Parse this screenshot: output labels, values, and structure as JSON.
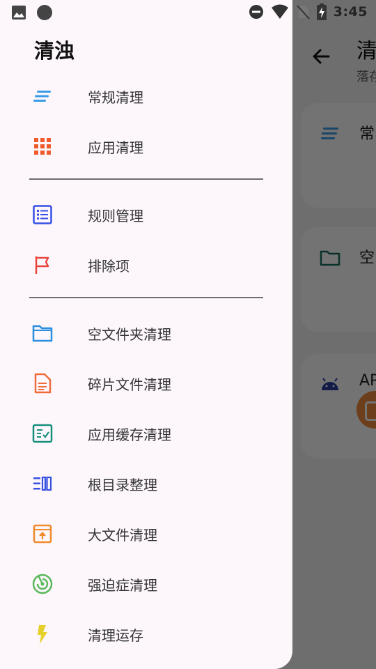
{
  "status_bar": {
    "time": "3:45",
    "icons": [
      "image-icon",
      "circle-icon",
      "dnd-icon",
      "wifi-icon",
      "no-sim-icon",
      "battery-charging-icon"
    ]
  },
  "background": {
    "title": "清",
    "subtitle": "落存",
    "cards": [
      {
        "icon": "lines-icon",
        "label": "常"
      },
      {
        "icon": "folder-icon",
        "label": "空"
      },
      {
        "icon": "android-icon",
        "label": "AP"
      }
    ]
  },
  "drawer": {
    "title": "清浊",
    "items": [
      {
        "label": "常规清理",
        "icon": "lines-icon",
        "color": "#3a9be6"
      },
      {
        "label": "应用清理",
        "icon": "grid-icon",
        "color": "#ef5c2b"
      },
      {
        "label": "规则管理",
        "icon": "list-icon",
        "color": "#3550e3"
      },
      {
        "label": "排除项",
        "icon": "flag-icon",
        "color": "#e8473c"
      },
      {
        "label": "空文件夹清理",
        "icon": "folder-icon",
        "color": "#2b8fe0"
      },
      {
        "label": "碎片文件清理",
        "icon": "document-icon",
        "color": "#f06a3a"
      },
      {
        "label": "应用缓存清理",
        "icon": "checklist-icon",
        "color": "#168f7c"
      },
      {
        "label": "根目录整理",
        "icon": "columns-icon",
        "color": "#3550e3"
      },
      {
        "label": "大文件清理",
        "icon": "upload-box-icon",
        "color": "#f08a2a"
      },
      {
        "label": "强迫症清理",
        "icon": "radar-icon",
        "color": "#5cb85c"
      },
      {
        "label": "清理运存",
        "icon": "bolt-icon",
        "color": "#e6d02a"
      }
    ]
  }
}
